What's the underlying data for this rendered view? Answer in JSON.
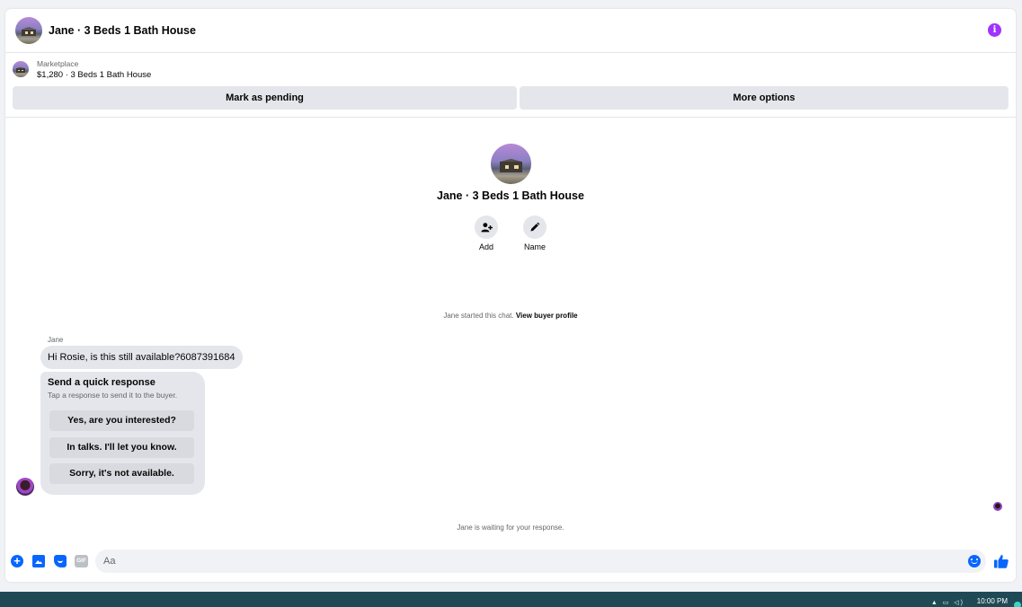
{
  "header": {
    "title": "Jane · 3 Beds 1 Bath House",
    "info_icon": "info-icon",
    "accent_color": "#a033ff"
  },
  "marketplace": {
    "label": "Marketplace",
    "listing": "$1,280 · 3 Beds 1 Bath House"
  },
  "actions": {
    "pending": "Mark as pending",
    "more": "More options"
  },
  "profile": {
    "name": "Jane · 3 Beds 1 Bath House",
    "add_label": "Add",
    "name_label": "Name"
  },
  "chat": {
    "started_text": "Jane started this chat.",
    "view_profile_link": "View buyer profile",
    "sender": "Jane",
    "message": "Hi Rosie, is this still available?6087391684",
    "quick_response": {
      "title": "Send a quick response",
      "subtitle": "Tap a response to send it to the buyer.",
      "options": [
        "Yes, are you interested?",
        "In talks. I'll let you know.",
        "Sorry, it's not available."
      ]
    },
    "waiting_text": "Jane is waiting for your response."
  },
  "composer": {
    "placeholder": "Aa",
    "gif_label": "GIF",
    "brand_color": "#0866ff"
  },
  "taskbar": {
    "time": "10:00 PM"
  }
}
